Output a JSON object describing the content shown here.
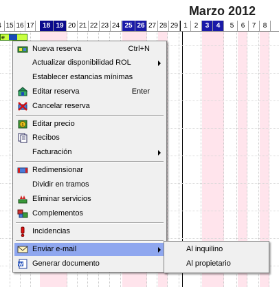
{
  "calendar": {
    "month_title": "Marzo 2012",
    "days": [
      "4",
      "15",
      "16",
      "17",
      "18",
      "19",
      "20",
      "21",
      "22",
      "23",
      "24",
      "25",
      "26",
      "27",
      "28",
      "29",
      "1",
      "2",
      "3",
      "4",
      "5",
      "6",
      "7",
      "8"
    ],
    "booking_label": "e"
  },
  "context_menu": {
    "items": [
      {
        "label": "Nueva reserva",
        "shortcut": "Ctrl+N",
        "icon": "new-reservation-icon"
      },
      {
        "label": "Actualizar disponibilidad ROL",
        "submenu": true
      },
      {
        "label": "Establecer estancias mínimas"
      },
      {
        "label": "Editar reserva",
        "shortcut": "Enter",
        "icon": "edit-reservation-icon"
      },
      {
        "label": "Cancelar reserva",
        "icon": "cancel-reservation-icon"
      },
      {
        "label": "Editar precio",
        "icon": "edit-price-icon"
      },
      {
        "label": "Recibos",
        "icon": "receipts-icon"
      },
      {
        "label": "Facturación",
        "submenu": true
      },
      {
        "label": "Redimensionar",
        "icon": "resize-icon"
      },
      {
        "label": "Dividir en tramos"
      },
      {
        "label": "Eliminar servicios",
        "icon": "remove-services-icon"
      },
      {
        "label": "Complementos",
        "icon": "complements-icon"
      },
      {
        "label": "Incidencias",
        "icon": "incidents-icon"
      },
      {
        "label": "Enviar e-mail",
        "submenu": true,
        "icon": "email-icon",
        "highlighted": true
      },
      {
        "label": "Generar documento",
        "icon": "word-document-icon"
      }
    ]
  },
  "email_submenu": {
    "items": [
      {
        "label": "Al inquilino"
      },
      {
        "label": "Al propietario"
      }
    ]
  },
  "colors": {
    "menu_bg": "#f0f0f0",
    "highlight": "#8fa7ef",
    "weekend_header": "#0a0a8c",
    "weekend_column": "#ffe4ec",
    "booking": "#c8ff40"
  }
}
